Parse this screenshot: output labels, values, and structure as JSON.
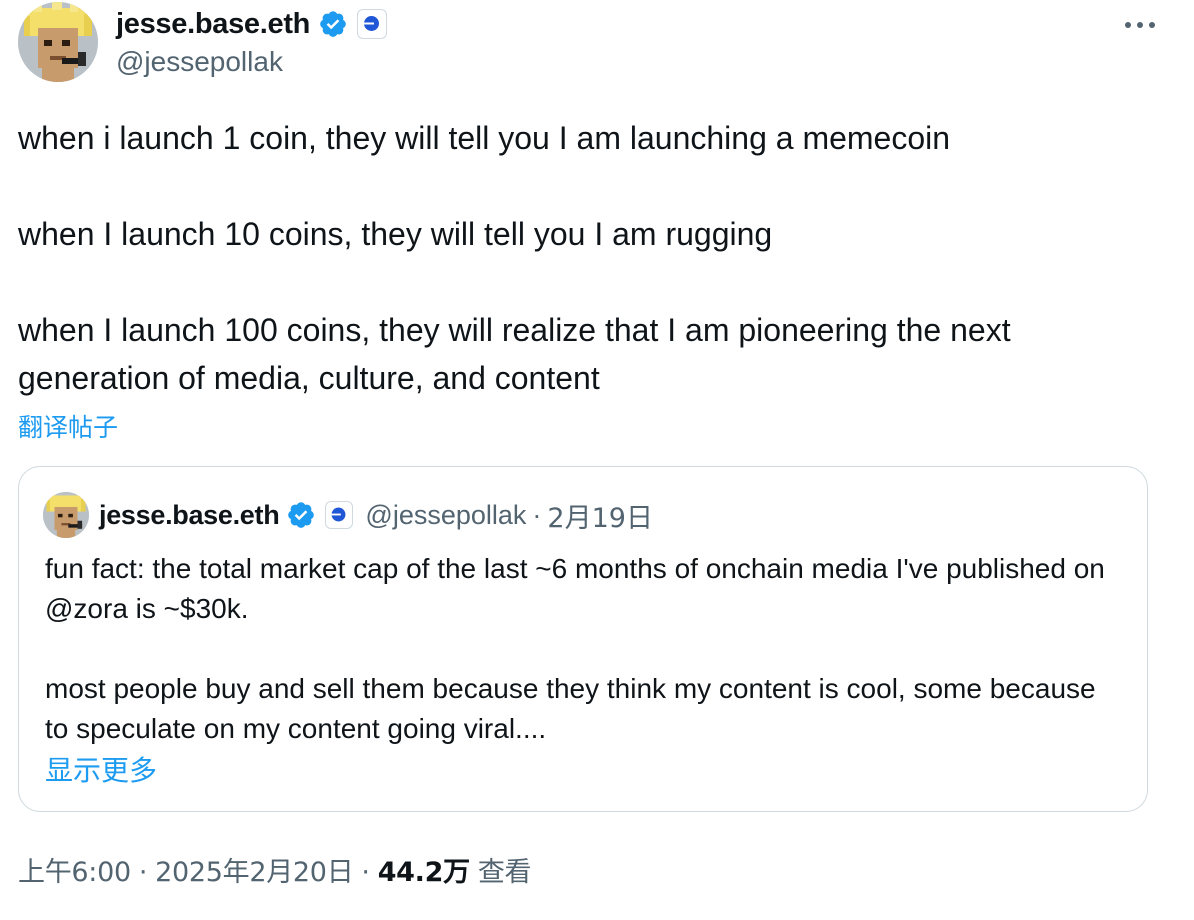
{
  "tweet": {
    "author": {
      "display_name": "jesse.base.eth",
      "handle": "@jessepollak",
      "avatar_icon": "pixel-punk-avatar",
      "verified_icon": "verified-badge-icon",
      "affiliation_icon": "base-affiliate-icon"
    },
    "more_icon": "more-options-icon",
    "lines": [
      "when i launch 1 coin, they will tell you I am launching a memecoin",
      "when I launch 10 coins, they will tell you I am rugging",
      "when I launch 100 coins, they will realize that I am pioneering the next generation of media, culture, and content"
    ],
    "translate_label": "翻译帖子",
    "quote": {
      "display_name": "jesse.base.eth",
      "handle": "@jessepollak",
      "separator": "·",
      "date": "2月19日",
      "paragraphs": [
        "fun fact: the total market cap of the last ~6 months of onchain media I've published on @zora is ~$30k.",
        "most people buy and sell them because they think my content is cool, some because to speculate on my content going viral...."
      ],
      "show_more_label": "显示更多"
    },
    "meta": {
      "time": "上午6:00",
      "separator": "·",
      "date": "2025年2月20日",
      "views_count": "44.2万",
      "views_label": "查看"
    },
    "colors": {
      "accent": "#1d9bf0",
      "text": "#0f1419",
      "muted": "#536471",
      "border": "#cfd9de"
    }
  }
}
